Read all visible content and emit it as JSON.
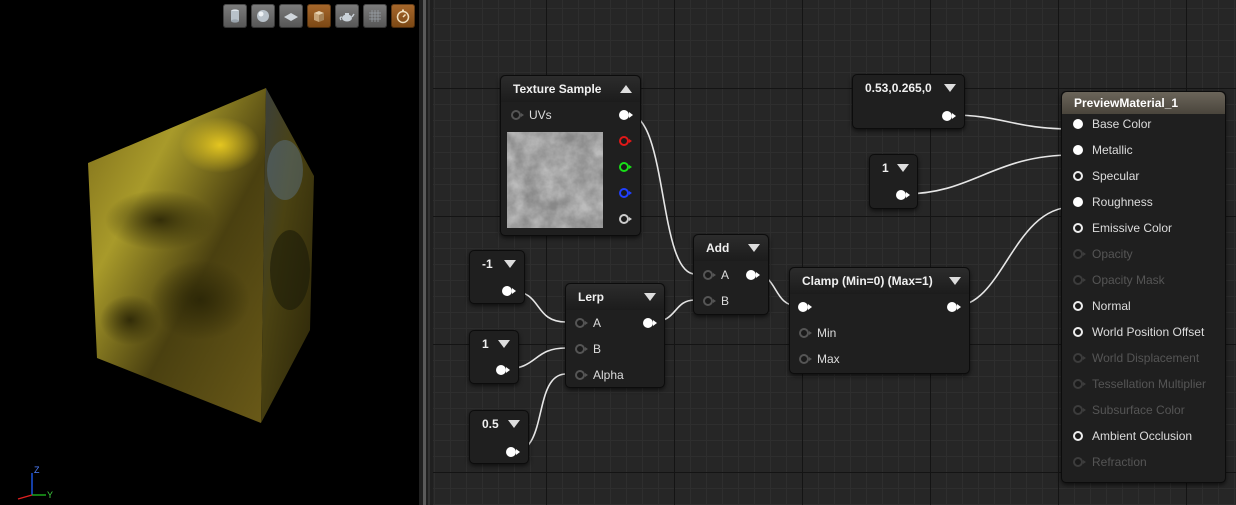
{
  "viewport": {
    "toolbar": [
      {
        "name": "cylinder-icon",
        "active": false
      },
      {
        "name": "sphere-icon",
        "active": false
      },
      {
        "name": "plane-icon",
        "active": false
      },
      {
        "name": "cube-icon",
        "active": true
      },
      {
        "name": "teapot-icon",
        "active": false
      },
      {
        "name": "grid-icon",
        "active": false
      },
      {
        "name": "realtime-icon",
        "active": true
      }
    ],
    "axis": {
      "z": "Z",
      "y": "Y"
    }
  },
  "nodes": {
    "texture_sample": {
      "title": "Texture Sample",
      "pins": {
        "uvs": "UVs"
      }
    },
    "const_neg1": {
      "value": "-1"
    },
    "const_1a": {
      "value": "1"
    },
    "const_05": {
      "value": "0.5"
    },
    "lerp": {
      "title": "Lerp",
      "pins": {
        "a": "A",
        "b": "B",
        "alpha": "Alpha"
      }
    },
    "add": {
      "title": "Add",
      "pins": {
        "a": "A",
        "b": "B"
      }
    },
    "clamp": {
      "title": "Clamp (Min=0) (Max=1)",
      "pins": {
        "min": "Min",
        "max": "Max"
      }
    },
    "const_color": {
      "value": "0.53,0.265,0"
    },
    "const_1b": {
      "value": "1"
    },
    "material": {
      "title": "PreviewMaterial_1",
      "pins": [
        {
          "label": "Base Color",
          "state": "connected"
        },
        {
          "label": "Metallic",
          "state": "connected"
        },
        {
          "label": "Specular",
          "state": "open"
        },
        {
          "label": "Roughness",
          "state": "connected"
        },
        {
          "label": "Emissive Color",
          "state": "open"
        },
        {
          "label": "Opacity",
          "state": "disabled"
        },
        {
          "label": "Opacity Mask",
          "state": "disabled"
        },
        {
          "label": "Normal",
          "state": "open"
        },
        {
          "label": "World Position Offset",
          "state": "open"
        },
        {
          "label": "World Displacement",
          "state": "disabled"
        },
        {
          "label": "Tessellation Multiplier",
          "state": "disabled"
        },
        {
          "label": "Subsurface Color",
          "state": "disabled"
        },
        {
          "label": "Ambient Occlusion",
          "state": "open"
        },
        {
          "label": "Refraction",
          "state": "disabled"
        }
      ]
    }
  },
  "colors": {
    "active_tool": "#a8682b",
    "wire": "#e6e6e6",
    "cube_gold": "#b8a020"
  }
}
